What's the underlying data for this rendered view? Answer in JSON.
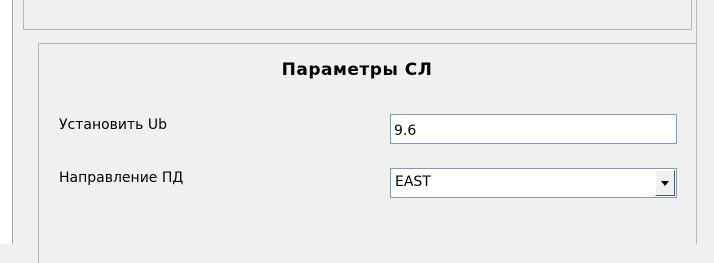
{
  "group": {
    "title": "Параметры СЛ"
  },
  "fields": {
    "ub": {
      "label": "Установить Ub",
      "value": "9.6"
    },
    "direction": {
      "label": "Направление ПД",
      "selected": "EAST"
    }
  },
  "icons": {
    "dropdown": "chevron-down-icon"
  }
}
